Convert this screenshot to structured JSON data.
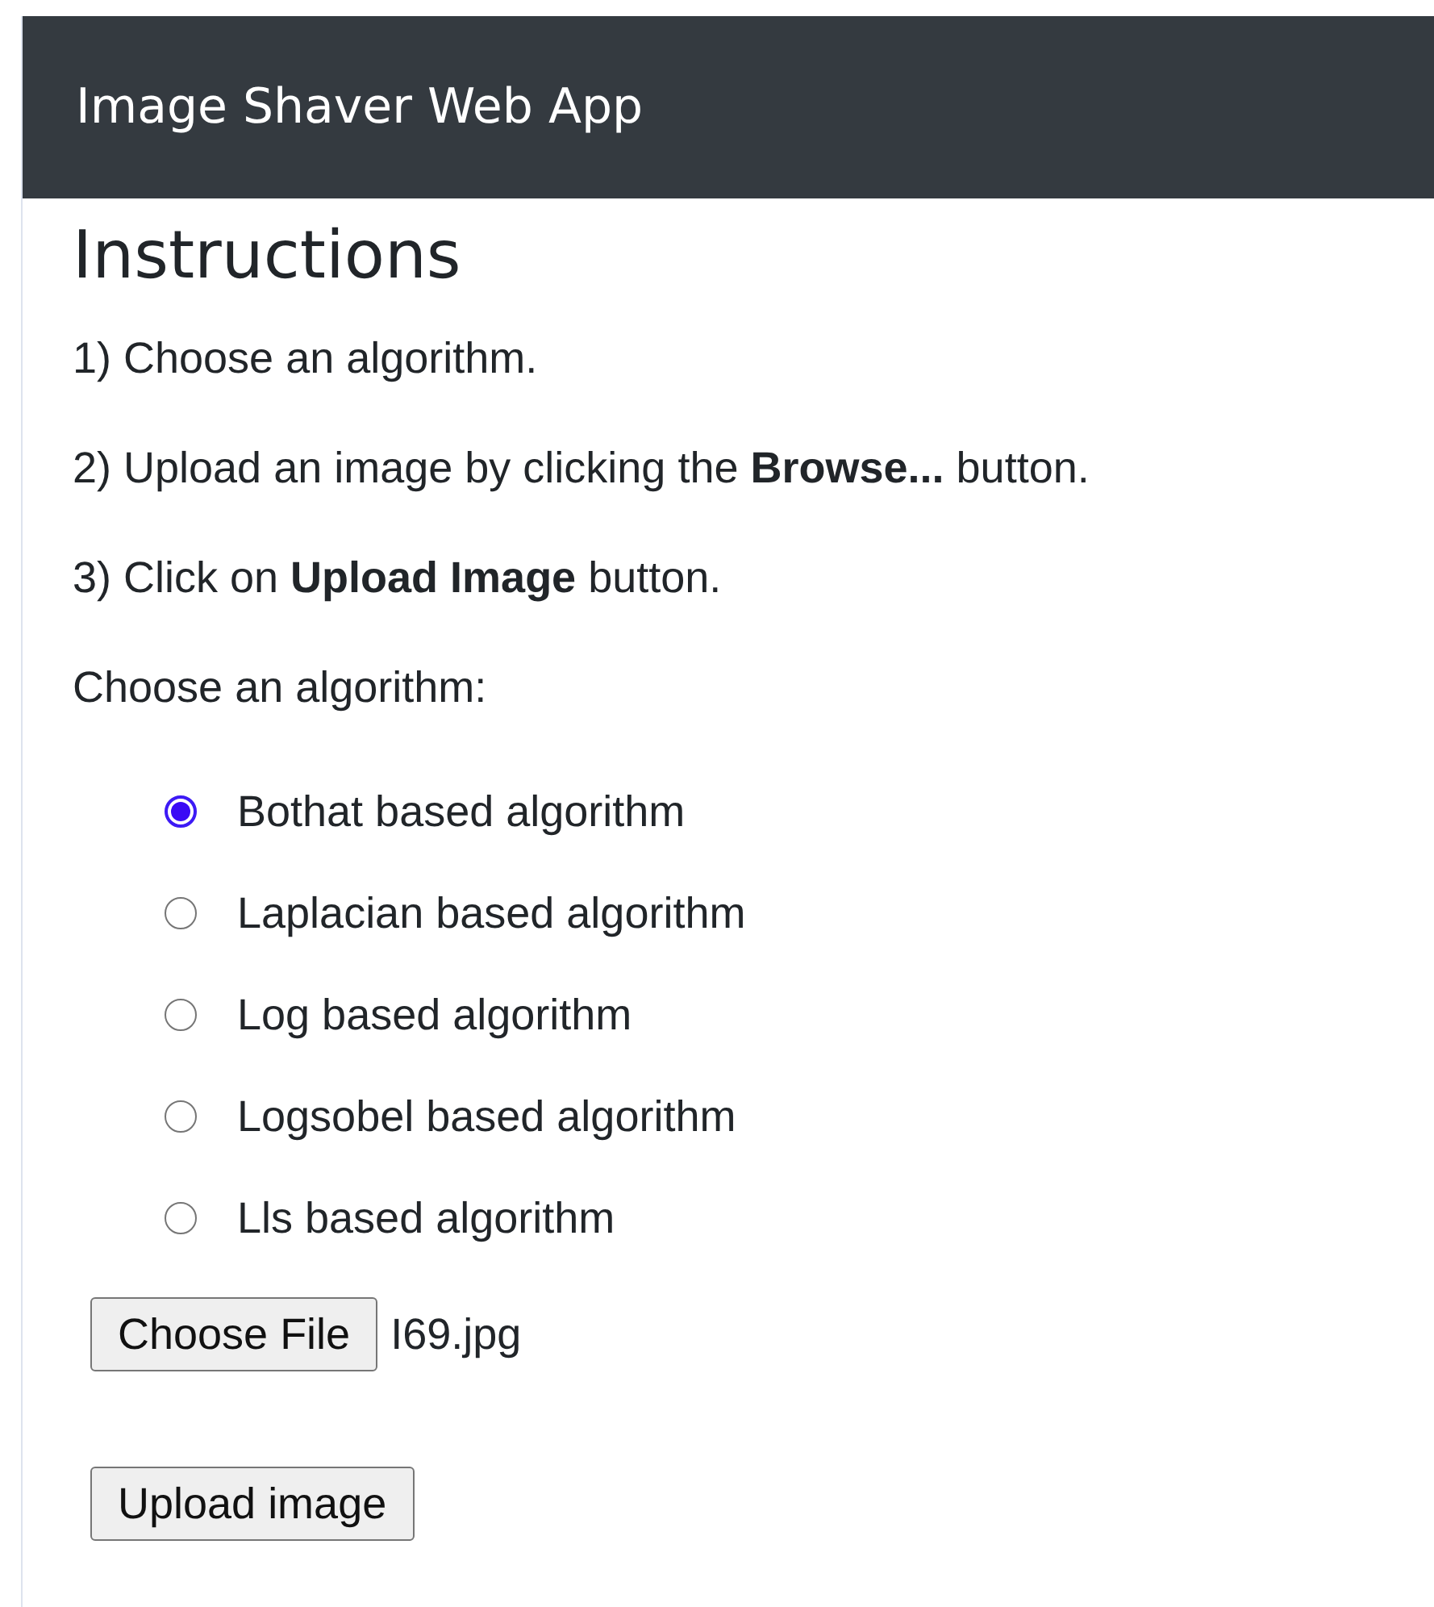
{
  "navbar": {
    "title": "Image Shaver Web App"
  },
  "instructions": {
    "heading": "Instructions",
    "steps": [
      "1) Choose an algorithm.",
      "2) Upload an image by clicking the **Browse...** button.",
      "3) Click on **Upload Image** button."
    ]
  },
  "algorithm_prompt": "Choose an algorithm:",
  "algorithms": [
    {
      "label": "Bothat based algorithm",
      "selected": true
    },
    {
      "label": "Laplacian based algorithm",
      "selected": false
    },
    {
      "label": "Log based algorithm",
      "selected": false
    },
    {
      "label": "Logsobel based algorithm",
      "selected": false
    },
    {
      "label": "Lls based algorithm",
      "selected": false
    }
  ],
  "file_input": {
    "button": "Choose File",
    "value": "I69.jpg"
  },
  "upload_button": "Upload image"
}
